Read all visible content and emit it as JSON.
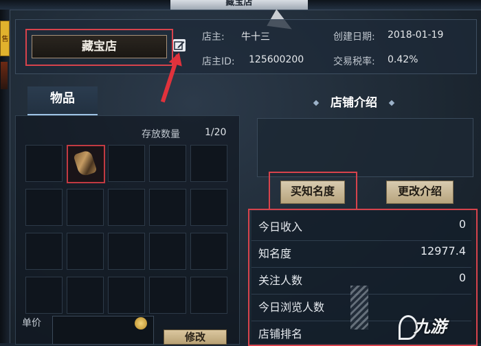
{
  "window": {
    "title": "藏宝店"
  },
  "sidebar": {
    "tag_text": "售"
  },
  "shop": {
    "name": "藏宝店",
    "owner_label": "店主:",
    "owner_value": "牛十三",
    "owner_id_label": "店主ID:",
    "owner_id_value": "125600200",
    "created_label": "创建日期:",
    "created_value": "2018-01-19",
    "tax_label": "交易税率:",
    "tax_value": "0.42%"
  },
  "items": {
    "tab_label": "物品",
    "capacity_label": "存放数量",
    "capacity_value": "1/20",
    "grid_rows": 4,
    "grid_cols": 5,
    "filled_slots": [
      1
    ],
    "price_label": "单价",
    "modify_button": "修改"
  },
  "intro": {
    "title": "店铺介绍",
    "text": ""
  },
  "actions": {
    "buy_fame": "买知名度",
    "edit_intro": "更改介绍"
  },
  "stats": [
    {
      "label": "今日收入",
      "value": "0"
    },
    {
      "label": "知名度",
      "value": "12977.4"
    },
    {
      "label": "关注人数",
      "value": "0"
    },
    {
      "label": "今日浏览人数",
      "value": ""
    },
    {
      "label": "店铺排名",
      "value": ""
    }
  ],
  "watermark": {
    "text": "九游"
  },
  "colors": {
    "highlight_red": "#d8434c",
    "background": "#1b2633",
    "button_gold": "#d8cbb0"
  }
}
